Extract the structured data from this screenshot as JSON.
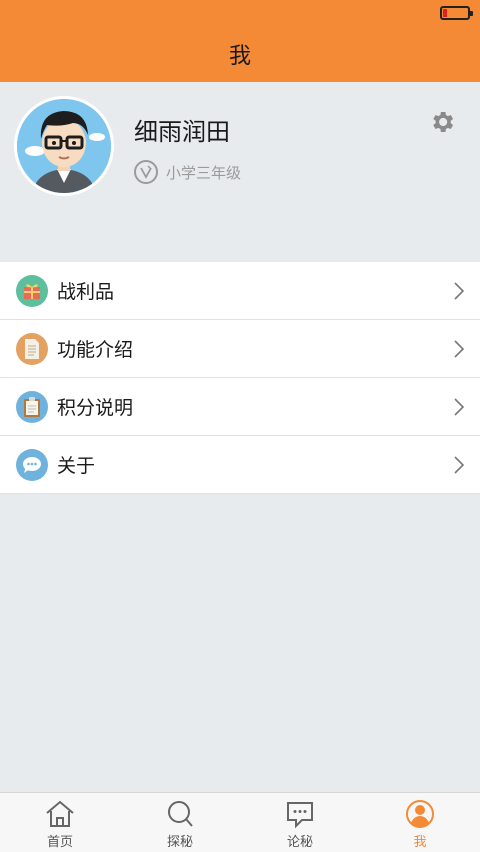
{
  "header": {
    "title": "我"
  },
  "profile": {
    "name": "细雨润田",
    "grade": "小学三年级"
  },
  "menu": [
    {
      "label": "战利品",
      "icon": "gift-icon",
      "color": "#5dbf9b"
    },
    {
      "label": "功能介绍",
      "icon": "document-icon",
      "color": "#e3a162"
    },
    {
      "label": "积分说明",
      "icon": "clipboard-icon",
      "color": "#6fb2dd"
    },
    {
      "label": "关于",
      "icon": "chat-bubble-icon",
      "color": "#6fb2dd"
    }
  ],
  "tabbar": [
    {
      "label": "首页",
      "icon": "home-icon",
      "active": false
    },
    {
      "label": "探秘",
      "icon": "search-icon",
      "active": false
    },
    {
      "label": "论秘",
      "icon": "message-icon",
      "active": false
    },
    {
      "label": "我",
      "icon": "user-icon",
      "active": true
    }
  ],
  "colors": {
    "accent": "#f48a35",
    "background": "#e8ebee"
  }
}
